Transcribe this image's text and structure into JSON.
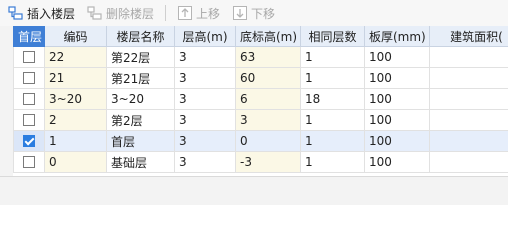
{
  "toolbar": {
    "insert_label": "插入楼层",
    "delete_label": "删除楼层",
    "up_label": "上移",
    "down_label": "下移"
  },
  "table": {
    "headers": [
      "首层",
      "编码",
      "楼层名称",
      "层高(m)",
      "底标高(m)",
      "相同层数",
      "板厚(mm)",
      "建筑面积("
    ],
    "rows": [
      {
        "checked": false,
        "code": "22",
        "name": "第22层",
        "height": "3",
        "base": "63",
        "same": "1",
        "thickness": "100",
        "area": ""
      },
      {
        "checked": false,
        "code": "21",
        "name": "第21层",
        "height": "3",
        "base": "60",
        "same": "1",
        "thickness": "100",
        "area": ""
      },
      {
        "checked": false,
        "code": "3~20",
        "name": "3~20",
        "height": "3",
        "base": "6",
        "same": "18",
        "thickness": "100",
        "area": ""
      },
      {
        "checked": false,
        "code": "2",
        "name": "第2层",
        "height": "3",
        "base": "3",
        "same": "1",
        "thickness": "100",
        "area": ""
      },
      {
        "checked": true,
        "code": "1",
        "name": "首层",
        "height": "3",
        "base": "0",
        "same": "1",
        "thickness": "100",
        "area": ""
      },
      {
        "checked": false,
        "code": "0",
        "name": "基础层",
        "height": "3",
        "base": "-3",
        "same": "1",
        "thickness": "100",
        "area": ""
      }
    ]
  },
  "colors": {
    "header_first_bg": "#3f7fd6",
    "editable_cell_bg": "#fbf8e6",
    "selected_row_bg": "#e6eefb"
  }
}
